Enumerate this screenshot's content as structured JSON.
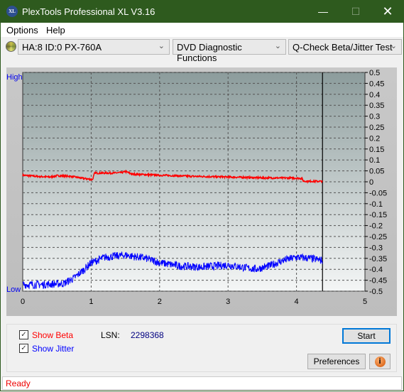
{
  "window": {
    "title": "PlexTools Professional XL V3.16",
    "logo": "XL"
  },
  "menu": {
    "options": "Options",
    "help": "Help"
  },
  "toolbar": {
    "drive": "HA:8 ID:0  PX-760A",
    "function": "DVD Diagnostic Functions",
    "test": "Q-Check Beta/Jitter Test"
  },
  "chart_labels": {
    "high": "High",
    "low": "Low"
  },
  "chart_data": {
    "type": "line",
    "xlim": [
      0,
      5
    ],
    "ylim": [
      -0.5,
      0.5
    ],
    "x_ticks": [
      "0",
      "1",
      "2",
      "3",
      "4",
      "5"
    ],
    "y_ticks": [
      "0.5",
      "0.45",
      "0.4",
      "0.35",
      "0.3",
      "0.25",
      "0.2",
      "0.15",
      "0.1",
      "0.05",
      "0",
      "-0.05",
      "-0.1",
      "-0.15",
      "-0.2",
      "-0.25",
      "-0.3",
      "-0.35",
      "-0.4",
      "-0.45",
      "-0.5"
    ],
    "grid": true,
    "cursor_x": 4.38,
    "series": [
      {
        "color": "#ff0000",
        "x": [
          0,
          0.2,
          0.4,
          0.5,
          0.7,
          0.9,
          1.02,
          1.05,
          1.3,
          1.45,
          1.5,
          1.6,
          2.0,
          2.5,
          3.0,
          3.5,
          4.0,
          4.08,
          4.1,
          4.38
        ],
        "y": [
          0.03,
          0.025,
          0.022,
          0.028,
          0.025,
          0.015,
          0.01,
          0.04,
          0.04,
          0.042,
          0.047,
          0.035,
          0.03,
          0.025,
          0.022,
          0.018,
          0.017,
          0.015,
          0.003,
          0.002
        ]
      },
      {
        "color": "#0000ff",
        "x": [
          0,
          0.3,
          0.6,
          0.75,
          0.9,
          1.0,
          1.2,
          1.5,
          1.8,
          2.0,
          2.3,
          2.6,
          3.0,
          3.2,
          3.4,
          3.6,
          3.8,
          4.0,
          4.2,
          4.38
        ],
        "y": [
          -0.47,
          -0.47,
          -0.465,
          -0.44,
          -0.4,
          -0.37,
          -0.345,
          -0.335,
          -0.35,
          -0.37,
          -0.385,
          -0.39,
          -0.38,
          -0.39,
          -0.4,
          -0.385,
          -0.36,
          -0.345,
          -0.35,
          -0.36
        ]
      }
    ]
  },
  "options": {
    "show_beta": "Show Beta",
    "show_jitter": "Show Jitter",
    "beta_checked": true,
    "jitter_checked": true,
    "beta_color": "#ff0000",
    "jitter_color": "#0000ff"
  },
  "lsn": {
    "label": "LSN:",
    "value": "2298368"
  },
  "buttons": {
    "start": "Start",
    "preferences": "Preferences"
  },
  "status": "Ready"
}
